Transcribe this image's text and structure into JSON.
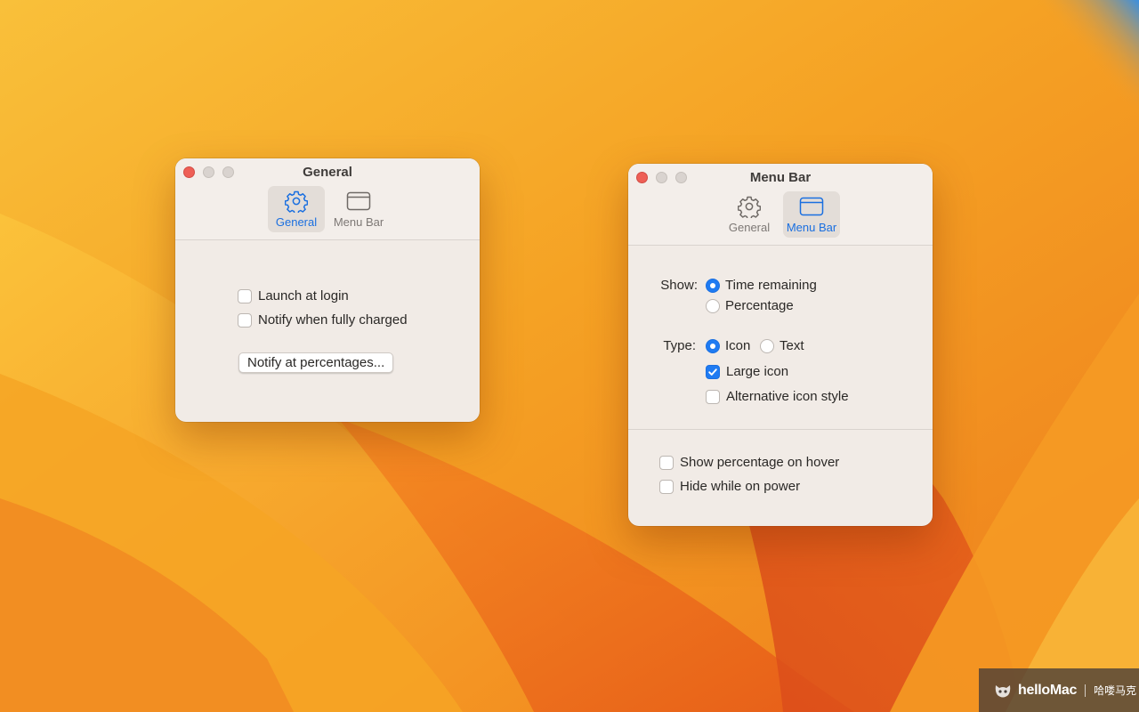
{
  "desktop": {
    "wallpaper_colors": [
      "#f7b52a",
      "#f39a1c",
      "#ee7a1c",
      "#e45a1a",
      "#3b8fd9"
    ]
  },
  "general_window": {
    "title": "General",
    "tabs": [
      {
        "label": "General",
        "icon": "gear-icon",
        "active": true
      },
      {
        "label": "Menu Bar",
        "icon": "window-icon",
        "active": false
      }
    ],
    "launch_at_login": {
      "label": "Launch at login",
      "checked": false
    },
    "notify_fully_charged": {
      "label": "Notify when fully charged",
      "checked": false
    },
    "notify_percentages_button": "Notify at percentages..."
  },
  "menubar_window": {
    "title": "Menu Bar",
    "tabs": [
      {
        "label": "General",
        "icon": "gear-icon",
        "active": false
      },
      {
        "label": "Menu Bar",
        "icon": "window-icon",
        "active": true
      }
    ],
    "show_label": "Show:",
    "show_options": [
      {
        "label": "Time remaining",
        "selected": true
      },
      {
        "label": "Percentage",
        "selected": false
      }
    ],
    "type_label": "Type:",
    "type_options": [
      {
        "label": "Icon",
        "selected": true
      },
      {
        "label": "Text",
        "selected": false
      }
    ],
    "large_icon": {
      "label": "Large icon",
      "checked": true
    },
    "alt_icon_style": {
      "label": "Alternative icon style",
      "checked": false
    },
    "show_percentage_hover": {
      "label": "Show percentage on hover",
      "checked": false
    },
    "hide_on_power": {
      "label": "Hide while on power",
      "checked": false
    }
  },
  "watermark": {
    "brand": "helloMac",
    "chinese": "哈喽马克"
  },
  "colors": {
    "accent": "#1f7bf2",
    "close_button": "#ee5f56",
    "window_bg": "#f1ebe6"
  }
}
